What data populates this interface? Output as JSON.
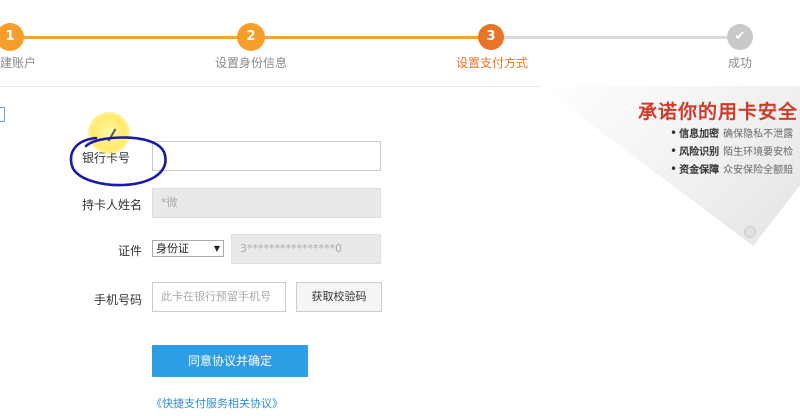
{
  "steps": [
    {
      "number": "1",
      "label": "建账户",
      "state": "done"
    },
    {
      "number": "2",
      "label": "设置身份信息",
      "state": "done"
    },
    {
      "number": "3",
      "label": "设置支付方式",
      "state": "active"
    },
    {
      "number": "✔",
      "label": "成功",
      "state": "todo"
    }
  ],
  "promo": {
    "title": "承诺你的用卡安全",
    "items": [
      {
        "bold": "信息加密",
        "text": "确保隐私不泄露"
      },
      {
        "bold": "风险识别",
        "text": "陌生环境要安检"
      },
      {
        "bold": "资金保障",
        "text": "众安保险全额赔"
      }
    ]
  },
  "form": {
    "card_label": "银行卡号",
    "card_value": "",
    "name_label": "持卡人姓名",
    "name_value": "*微",
    "id_label": "证件",
    "id_type": "身份证",
    "id_value": "3****************0",
    "phone_label": "手机号码",
    "phone_placeholder": "此卡在银行预留手机号",
    "get_code_label": "获取校验码",
    "submit_label": "同意协议并确定",
    "agreement_link": "《快捷支付服务相关协议》"
  },
  "colors": {
    "step_done": "#f59e2c",
    "step_active": "#e8742a",
    "step_todo": "#c9c9c9",
    "submit": "#2d9ee3",
    "promo_title": "#cf3b2a",
    "annotation_ink": "#1a1aa8"
  }
}
